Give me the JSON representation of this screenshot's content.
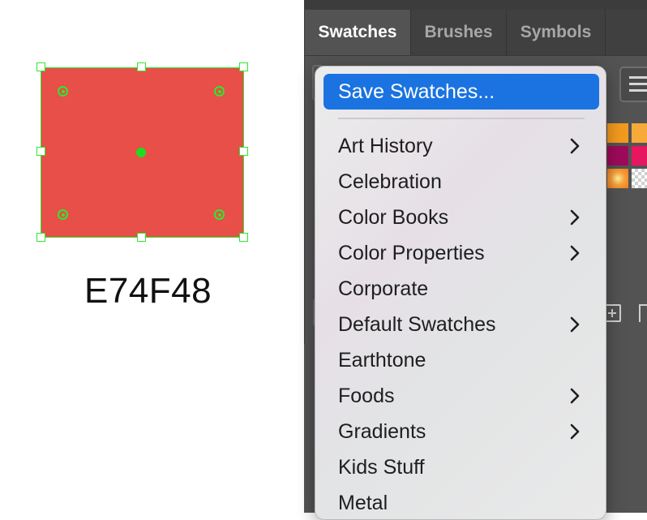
{
  "canvas": {
    "fill_color": "#E74F48",
    "selection_color": "#2ee82e",
    "color_label": "E74F48"
  },
  "panel": {
    "tabs": [
      {
        "label": "Swatches",
        "active": true
      },
      {
        "label": "Brushes",
        "active": false
      },
      {
        "label": "Symbols",
        "active": false
      }
    ],
    "visible_swatches": [
      "#f39a1e",
      "#f7a93a",
      "#9e0a5a",
      "#e6165f",
      "radial-gradient-orange",
      "none-transparent"
    ],
    "footer_icons": [
      "new-swatch-icon",
      "trash-icon"
    ]
  },
  "menu": {
    "highlight_color": "#1a73e0",
    "items": [
      {
        "label": "Save Swatches...",
        "submenu": false,
        "highlighted": true
      },
      {
        "label": "Art History",
        "submenu": true
      },
      {
        "label": "Celebration",
        "submenu": false
      },
      {
        "label": "Color Books",
        "submenu": true
      },
      {
        "label": "Color Properties",
        "submenu": true
      },
      {
        "label": "Corporate",
        "submenu": false
      },
      {
        "label": "Default Swatches",
        "submenu": true
      },
      {
        "label": "Earthtone",
        "submenu": false
      },
      {
        "label": "Foods",
        "submenu": true
      },
      {
        "label": "Gradients",
        "submenu": true
      },
      {
        "label": "Kids Stuff",
        "submenu": false
      },
      {
        "label": "Metal",
        "submenu": false
      }
    ]
  }
}
